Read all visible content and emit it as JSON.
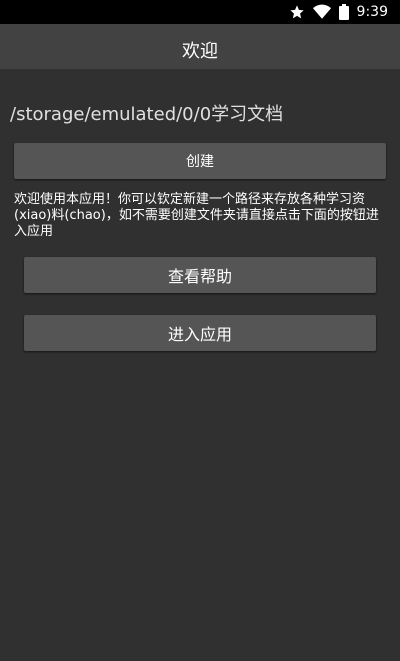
{
  "status_bar": {
    "time": "9:39",
    "icons": [
      "star-icon",
      "wifi-icon",
      "battery-icon"
    ]
  },
  "app_bar": {
    "title": "欢迎"
  },
  "main": {
    "path": "/storage/emulated/0/0学习文档",
    "create_button": "创建",
    "description": "欢迎使用本应用！你可以钦定新建一个路径来存放各种学习资(xiao)料(chao)，如不需要创建文件夹请直接点击下面的按钮进入应用",
    "help_button": "查看帮助",
    "enter_button": "进入应用"
  },
  "colors": {
    "background": "#303030",
    "app_bar": "#424242",
    "button": "#555555",
    "status_bar": "#000000"
  }
}
